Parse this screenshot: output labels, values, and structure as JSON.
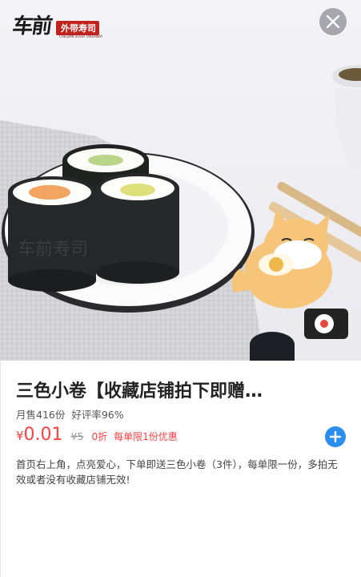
{
  "hero": {
    "logo_main": "车前",
    "logo_tag": "外带寿司",
    "logo_sub": "CHEQIAN SUSHI TAKEAWAY"
  },
  "icons": {
    "close": "close-icon",
    "add": "plus-icon"
  },
  "colors": {
    "price": "#ff4040",
    "add_button": "#2b8ff0"
  },
  "product": {
    "title": "三色小卷【收藏店铺拍下即赠…",
    "monthly_sales": "月售416份",
    "rating": "好评率96%",
    "price_symbol": "¥",
    "price": "0.01",
    "original_price": "¥5",
    "discount": "0折",
    "limit_note": "每单限1份优惠",
    "description": "首页右上角，点亮爱心，下单即送三色小卷（3件），每单限一份，多拍无效或者没有收藏店铺无效!"
  }
}
